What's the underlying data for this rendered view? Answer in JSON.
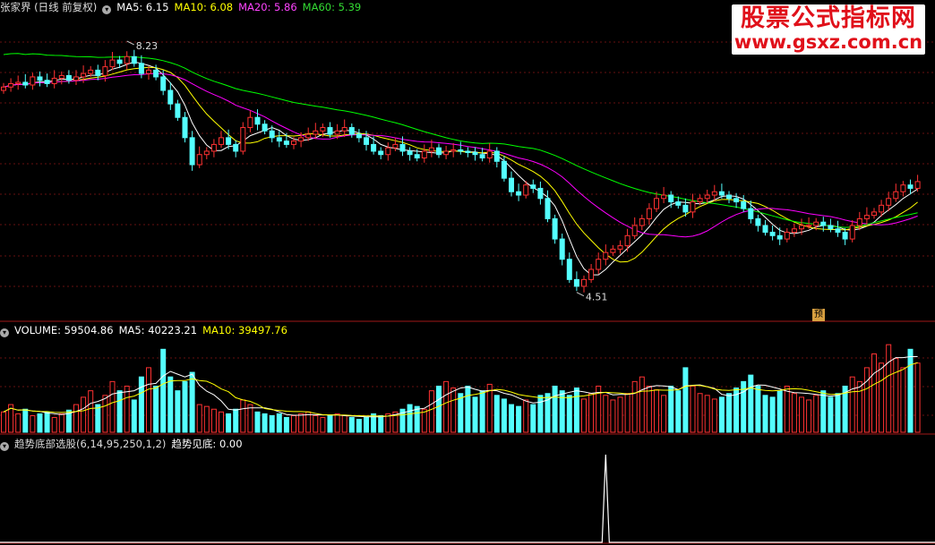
{
  "header": {
    "stock": "张家界 (日线 前复权)",
    "ma5": "MA5: 6.15",
    "ma10": "MA10: 6.08",
    "ma20": "MA20: 5.86",
    "ma60": "MA60: 5.39",
    "colors": {
      "ma5": "#ffffff",
      "ma10": "#ffff00",
      "ma20": "#ff00ff",
      "ma60": "#00ff00"
    }
  },
  "volume_header": {
    "volume": "VOLUME: 59504.86",
    "ma5": "MA5: 40223.21",
    "ma10": "MA10: 39497.76"
  },
  "indicator_header": {
    "name": "趋势底部选股(6,14,95,250,1,2)",
    "value": "趋势见底: 0.00"
  },
  "watermark": {
    "line1": "股票公式指标网",
    "line2": "www.gsxz.com.cn"
  },
  "labels": {
    "high": "8.23",
    "low": "4.51",
    "forecast": "预"
  },
  "chart_data": {
    "type": "candlestick",
    "price_range": [
      4.4,
      8.6
    ],
    "high": 8.23,
    "low": 4.51,
    "closes": [
      7.55,
      7.6,
      7.62,
      7.58,
      7.7,
      7.65,
      7.6,
      7.68,
      7.72,
      7.65,
      7.7,
      7.75,
      7.8,
      7.72,
      7.85,
      7.95,
      7.9,
      8.0,
      7.9,
      7.75,
      7.8,
      7.7,
      7.5,
      7.3,
      7.1,
      6.8,
      6.4,
      6.55,
      6.6,
      6.7,
      6.8,
      6.7,
      6.6,
      6.95,
      7.1,
      7.0,
      6.9,
      6.8,
      6.75,
      6.7,
      6.75,
      6.8,
      6.85,
      6.9,
      6.95,
      6.85,
      6.9,
      6.95,
      6.85,
      6.8,
      6.7,
      6.6,
      6.55,
      6.65,
      6.7,
      6.6,
      6.55,
      6.5,
      6.6,
      6.65,
      6.55,
      6.6,
      6.62,
      6.6,
      6.58,
      6.55,
      6.5,
      6.6,
      6.45,
      6.2,
      6.0,
      5.95,
      6.1,
      6.05,
      5.9,
      5.6,
      5.3,
      5.0,
      4.7,
      4.6,
      4.7,
      4.85,
      5.0,
      5.1,
      5.15,
      5.2,
      5.35,
      5.5,
      5.6,
      5.75,
      5.9,
      5.95,
      5.85,
      5.8,
      5.7,
      5.85,
      5.9,
      5.95,
      6.0,
      5.95,
      5.9,
      5.85,
      5.75,
      5.6,
      5.5,
      5.4,
      5.35,
      5.3,
      5.4,
      5.45,
      5.5,
      5.5,
      5.55,
      5.5,
      5.45,
      5.4,
      5.3,
      5.5,
      5.6,
      5.65,
      5.7,
      5.8,
      5.9,
      6.0,
      6.1,
      6.05,
      6.15
    ],
    "volume": {
      "last": 59504.86,
      "ma5": 40223.21,
      "ma10": 39497.76,
      "values": [
        0.22,
        0.3,
        0.2,
        0.25,
        0.18,
        0.2,
        0.22,
        0.16,
        0.2,
        0.24,
        0.3,
        0.38,
        0.45,
        0.3,
        0.4,
        0.55,
        0.45,
        0.5,
        0.35,
        0.6,
        0.7,
        0.5,
        0.9,
        0.6,
        0.45,
        0.55,
        0.65,
        0.3,
        0.28,
        0.25,
        0.22,
        0.2,
        0.25,
        0.35,
        0.3,
        0.22,
        0.2,
        0.18,
        0.2,
        0.16,
        0.18,
        0.2,
        0.22,
        0.18,
        0.16,
        0.18,
        0.2,
        0.18,
        0.16,
        0.14,
        0.16,
        0.2,
        0.18,
        0.2,
        0.22,
        0.25,
        0.3,
        0.28,
        0.25,
        0.45,
        0.5,
        0.55,
        0.48,
        0.42,
        0.5,
        0.38,
        0.45,
        0.52,
        0.4,
        0.36,
        0.3,
        0.28,
        0.35,
        0.3,
        0.4,
        0.42,
        0.5,
        0.45,
        0.4,
        0.48,
        0.36,
        0.42,
        0.5,
        0.4,
        0.35,
        0.38,
        0.42,
        0.55,
        0.6,
        0.5,
        0.46,
        0.4,
        0.5,
        0.45,
        0.7,
        0.5,
        0.42,
        0.4,
        0.36,
        0.38,
        0.42,
        0.48,
        0.55,
        0.62,
        0.5,
        0.4,
        0.38,
        0.45,
        0.5,
        0.42,
        0.38,
        0.35,
        0.4,
        0.45,
        0.38,
        0.42,
        0.5,
        0.6,
        0.55,
        0.7,
        0.85,
        0.75,
        0.95,
        0.8,
        0.7,
        0.9,
        0.75
      ]
    },
    "indicator": {
      "name": "趋势见底",
      "value": 0.0,
      "spike_index": 83
    }
  }
}
